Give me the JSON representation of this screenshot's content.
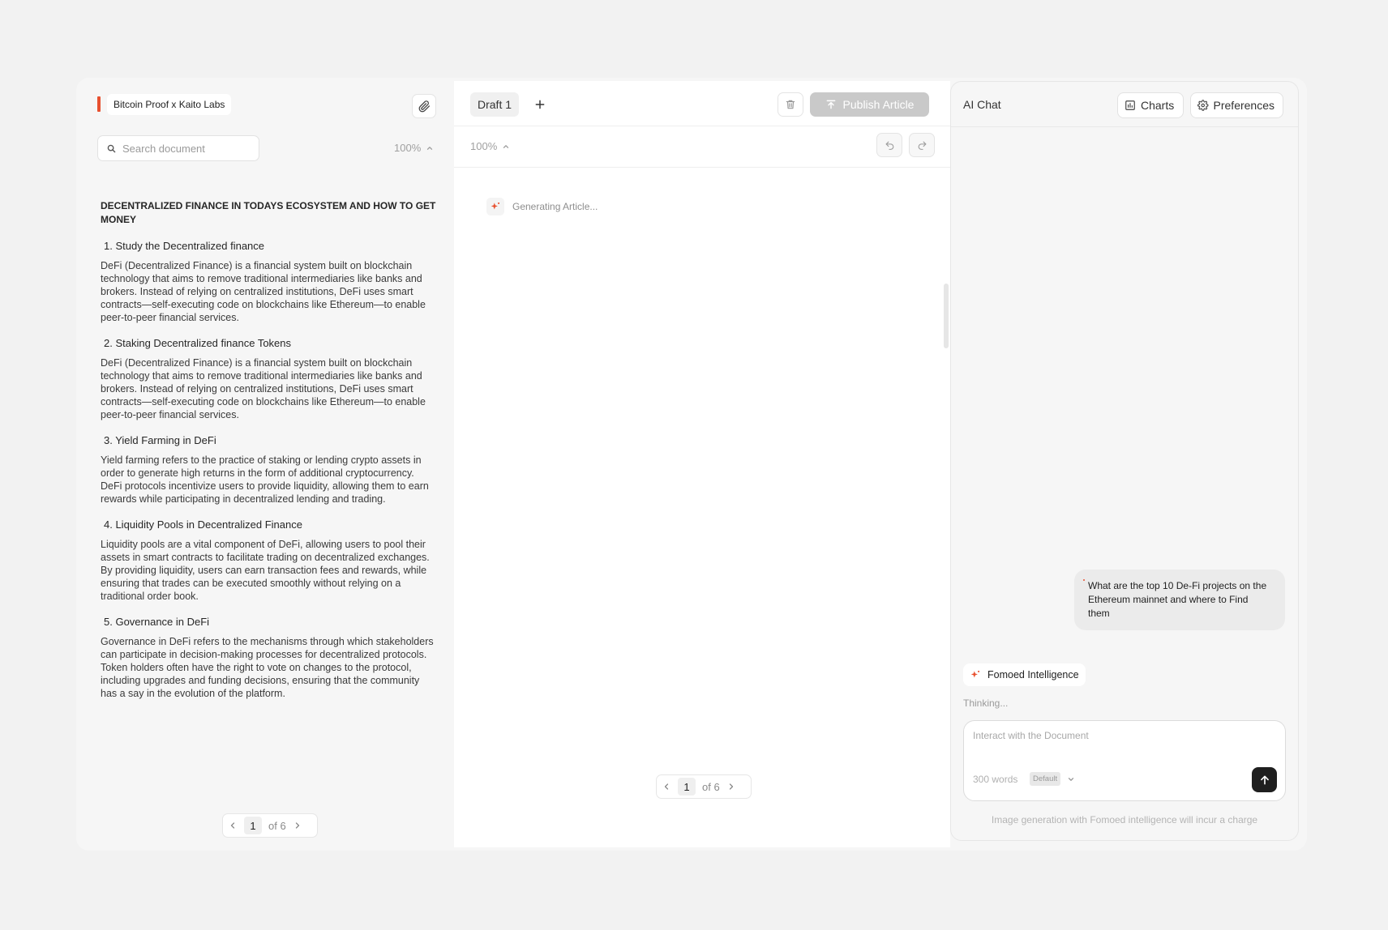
{
  "document": {
    "title": "Bitcoin Proof x Kaito Labs",
    "search_placeholder": "Search document",
    "zoom": "100%",
    "heading": "DECENTRALIZED FINANCE IN TODAYS ECOSYSTEM AND HOW TO GET MONEY",
    "sections": [
      {
        "title": "1. Study the Decentralized finance",
        "body": "DeFi (Decentralized Finance) is a financial system built on blockchain technology that aims to remove traditional intermediaries like banks and brokers. Instead of relying on centralized institutions, DeFi uses smart contracts—self-executing code on blockchains like Ethereum—to enable peer-to-peer financial services."
      },
      {
        "title": "2. Staking Decentralized finance Tokens",
        "body": "DeFi (Decentralized Finance) is a financial system built on blockchain technology that aims to remove traditional intermediaries like banks and brokers. Instead of relying on centralized institutions, DeFi uses smart contracts—self-executing code on blockchains like Ethereum—to enable peer-to-peer financial services."
      },
      {
        "title": "3. Yield Farming in DeFi",
        "body": "Yield farming refers to the practice of staking or lending crypto assets in order to generate high returns in the form of additional cryptocurrency. DeFi protocols incentivize users to provide liquidity, allowing them to earn rewards while participating in decentralized lending and trading."
      },
      {
        "title": "4. Liquidity Pools in Decentralized Finance",
        "body": "Liquidity pools are a vital component of DeFi, allowing users to pool their assets in smart contracts to facilitate trading on decentralized exchanges. By providing liquidity, users can earn transaction fees and rewards, while ensuring that trades can be executed smoothly without relying on a traditional order book."
      },
      {
        "title": "5. Governance in DeFi",
        "body": "Governance in DeFi refers to the mechanisms through which stakeholders can participate in decision-making processes for decentralized protocols. Token holders often have the right to vote on changes to the protocol, including upgrades and funding decisions, ensuring that the community has a say in the evolution of the platform."
      }
    ],
    "pager": {
      "current": "1",
      "total": "of 6"
    }
  },
  "editor": {
    "tab_label": "Draft 1",
    "publish_label": "Publish Article",
    "zoom": "100%",
    "status": "Generating Article...",
    "pager": {
      "current": "1",
      "total": "of 6"
    }
  },
  "chat": {
    "title": "AI Chat",
    "charts_label": "Charts",
    "preferences_label": "Preferences",
    "user_message": "What are the top 10 De-Fi projects on the Ethereum mainnet and where to Find them",
    "assistant_name": "Fomoed Intelligence",
    "thinking": "Thinking...",
    "input_placeholder": "Interact with the Document",
    "word_count": "300 words",
    "mode": "Default",
    "footer_note": "Image generation with Fomoed intelligence will incur a charge"
  },
  "colors": {
    "accent": "#e8502f",
    "publish_disabled": "#c9c9c9",
    "send_button": "#1f1f1f"
  }
}
